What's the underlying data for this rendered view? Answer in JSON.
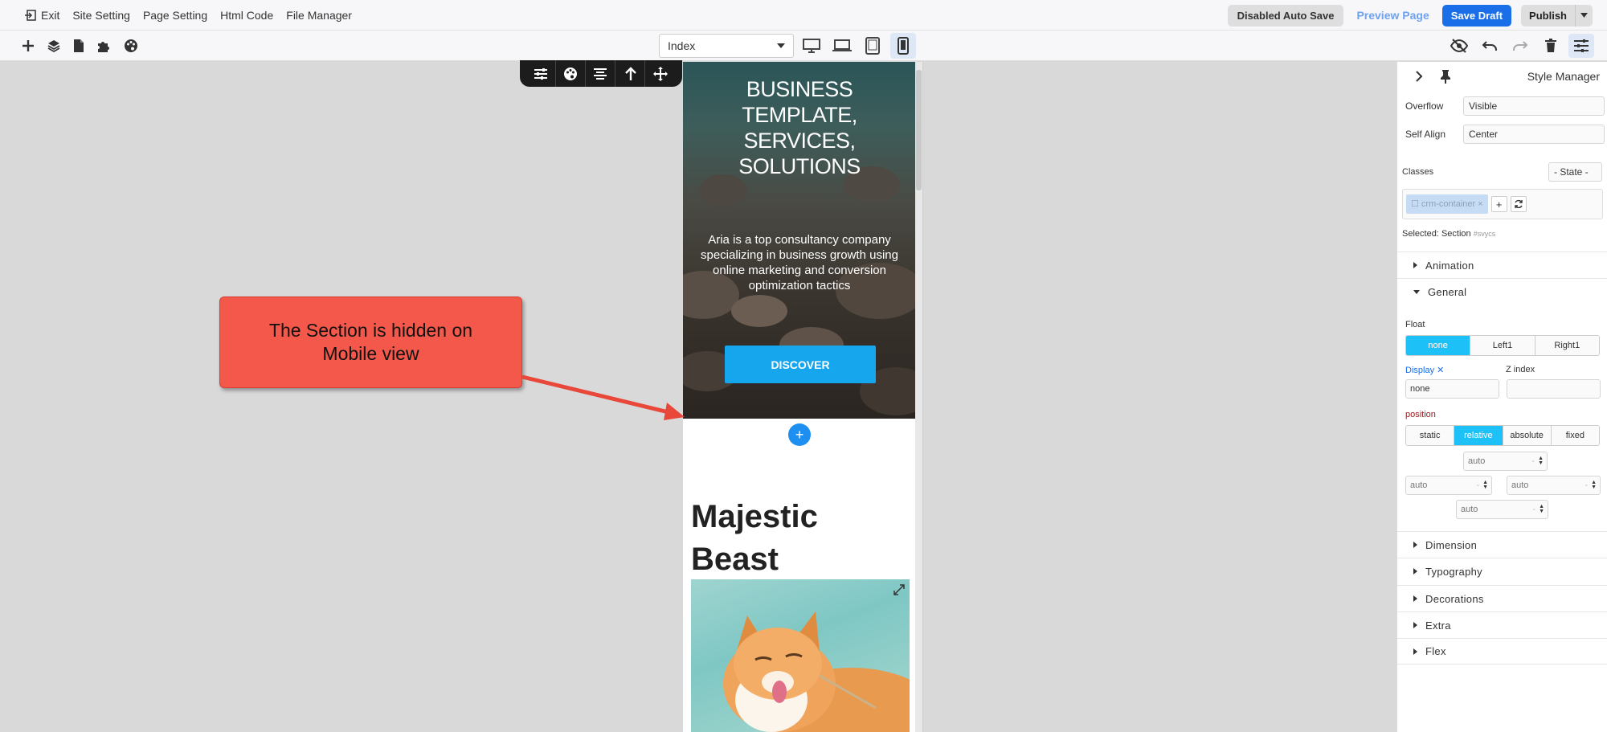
{
  "menubar": {
    "exit_label": "Exit",
    "items": [
      "Site Setting",
      "Page Setting",
      "Html Code",
      "File Manager"
    ],
    "disabled_autosave_label": "Disabled Auto Save",
    "preview_label": "Preview Page",
    "save_draft_label": "Save Draft",
    "publish_label": "Publish"
  },
  "toolbar": {
    "page_select_value": "Index",
    "active_device": "mobile"
  },
  "canvas": {
    "hero": {
      "title": "BUSINESS TEMPLATE, SERVICES, SOLUTIONS",
      "description": "Aria is a top consultancy company specializing in business growth using online marketing and conversion optimization tactics",
      "button_label": "DISCOVER"
    },
    "add_section_label": "+",
    "section_title": "Majestic Beast"
  },
  "callout": {
    "text": "The Section is hidden on Mobile view"
  },
  "style_manager": {
    "title": "Style Manager",
    "overflow": {
      "label": "Overflow",
      "value": "Visible"
    },
    "self_align": {
      "label": "Self Align",
      "value": "Center"
    },
    "classes_label": "Classes",
    "state_value": "- State -",
    "class_tag": "crm-container",
    "selected_label": "Selected:",
    "selected_name": "Section",
    "selected_id": "#svycs",
    "sectors": {
      "animation": "Animation",
      "general": "General",
      "dimension": "Dimension",
      "typography": "Typography",
      "decorations": "Decorations",
      "extra": "Extra",
      "flex": "Flex"
    },
    "float": {
      "label": "Float",
      "options": [
        "none",
        "Left1",
        "Right1"
      ],
      "selected": "none"
    },
    "display": {
      "label": "Display",
      "clear": "✕",
      "value": "none"
    },
    "z_index": {
      "label": "Z index",
      "value": ""
    },
    "position": {
      "label": "position",
      "options": [
        "static",
        "relative",
        "absolute",
        "fixed"
      ],
      "selected": "relative"
    },
    "offsets": {
      "top": "auto",
      "left": "auto",
      "right": "auto",
      "bottom": "auto",
      "unit": "-"
    }
  },
  "colors": {
    "accent": "#1a6ee8",
    "active_toggle": "#1ec1f7",
    "callout": "#f4584a",
    "hero_button": "#16a6ee",
    "position_label": "#9b1d20",
    "display_label": "#1a6ee8"
  }
}
